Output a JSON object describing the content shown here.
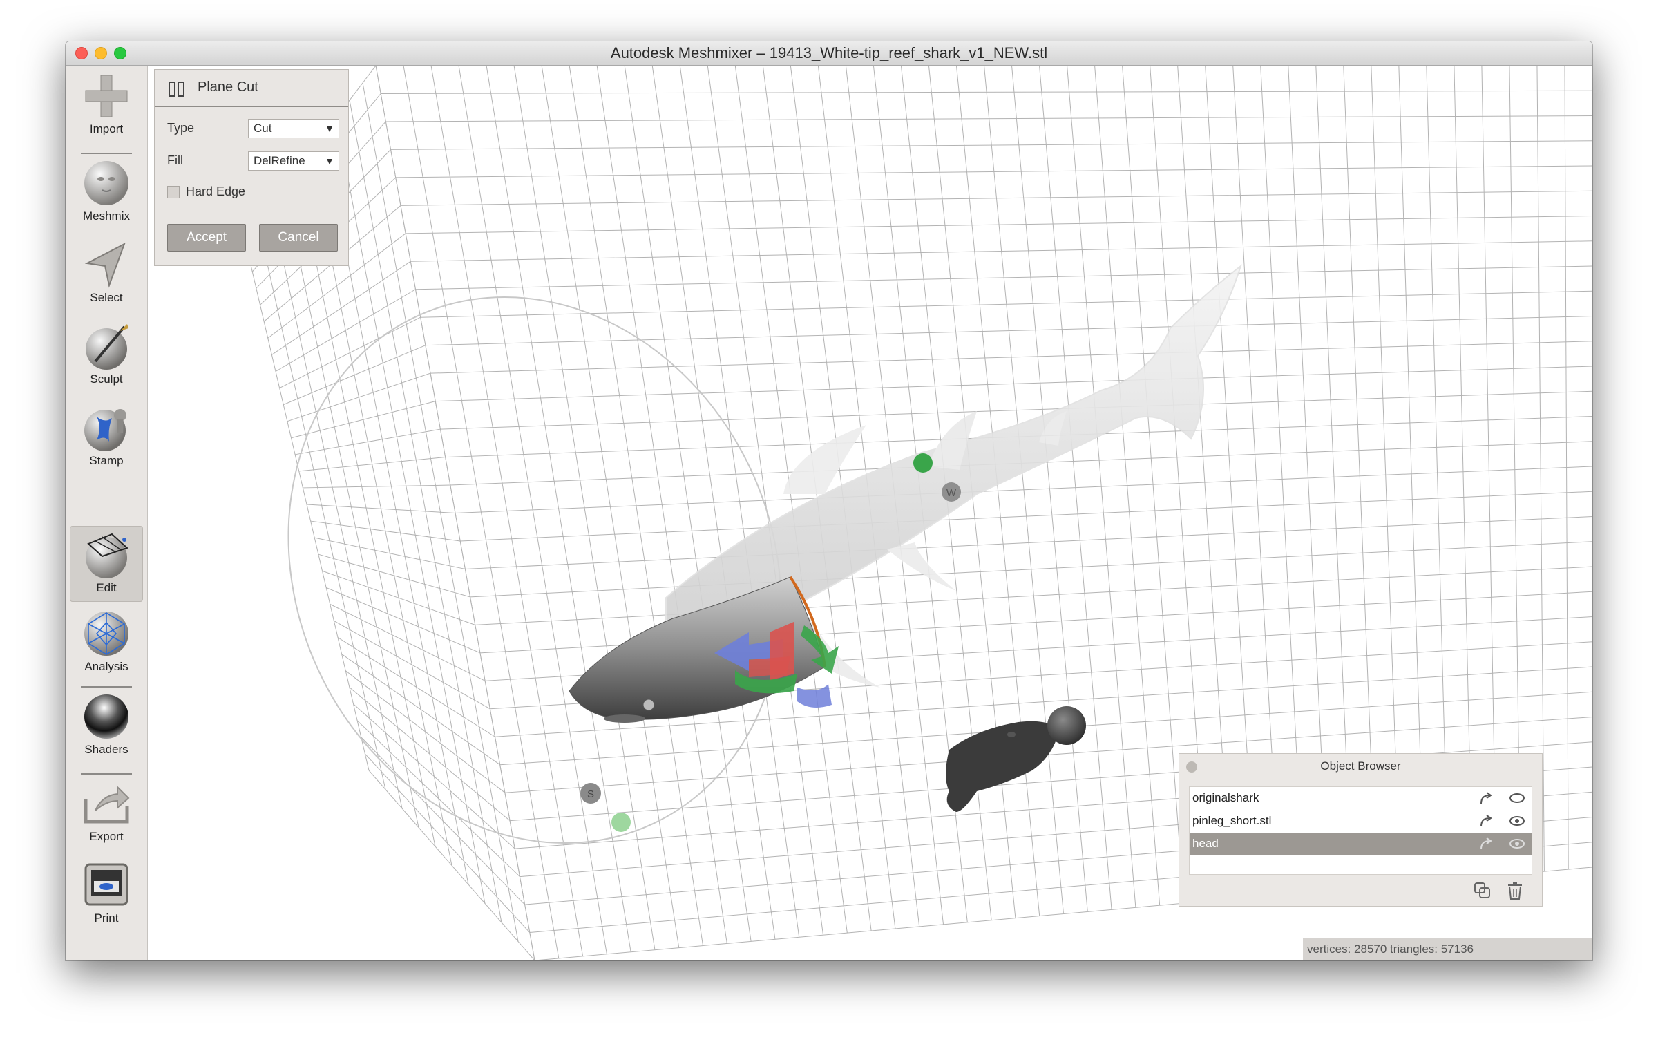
{
  "window": {
    "title": "Autodesk Meshmixer – 19413_White-tip_reef_shark_v1_NEW.stl"
  },
  "toolbar": {
    "items": [
      {
        "label": "Import",
        "icon": "plus-icon"
      },
      {
        "label": "Meshmix",
        "icon": "face-sphere-icon"
      },
      {
        "label": "Select",
        "icon": "cursor-arrow-icon"
      },
      {
        "label": "Sculpt",
        "icon": "brush-sphere-icon"
      },
      {
        "label": "Stamp",
        "icon": "stamp-sphere-icon"
      },
      {
        "label": "Edit",
        "icon": "edit-sphere-icon",
        "active": true
      },
      {
        "label": "Analysis",
        "icon": "mesh-sphere-icon"
      },
      {
        "label": "Shaders",
        "icon": "chrome-sphere-icon"
      },
      {
        "label": "Export",
        "icon": "export-tray-icon"
      },
      {
        "label": "Print",
        "icon": "printer-icon"
      }
    ]
  },
  "plane_cut": {
    "title": "Plane Cut",
    "type_label": "Type",
    "type_value": "Cut",
    "fill_label": "Fill",
    "fill_value": "DelRefine",
    "hard_edge_label": "Hard Edge",
    "hard_edge_checked": false,
    "accept_label": "Accept",
    "cancel_label": "Cancel"
  },
  "gizmo_labels": {
    "w": "W",
    "s": "S"
  },
  "object_browser": {
    "title": "Object Browser",
    "items": [
      {
        "name": "originalshark",
        "selected": false
      },
      {
        "name": "pinleg_short.stl",
        "selected": false
      },
      {
        "name": "head",
        "selected": true
      }
    ]
  },
  "status": {
    "text": "vertices: 28570 triangles: 57136"
  },
  "colors": {
    "accent_green": "#3aa54a",
    "accent_blue": "#6e7fd9",
    "accent_red": "#d9534f",
    "cut_edge": "#d2691e"
  }
}
